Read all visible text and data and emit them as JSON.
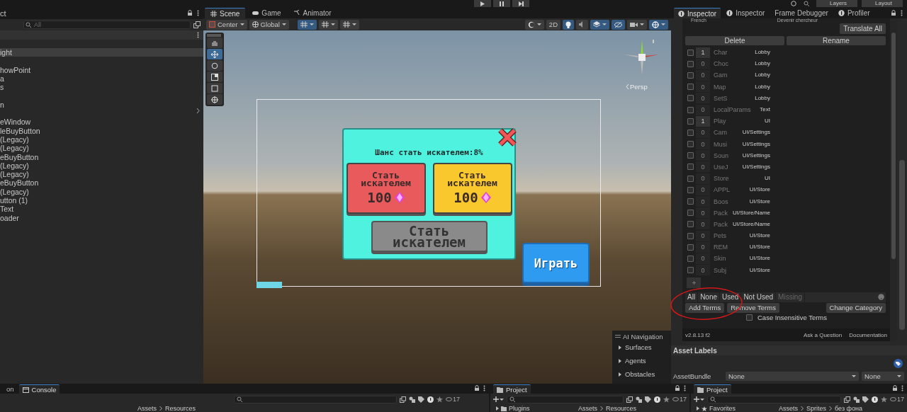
{
  "top_bar": {
    "dropdowns": [
      "Layers",
      "Layout"
    ]
  },
  "hierarchy": {
    "title": "ct",
    "search": {
      "placeholder": "All"
    },
    "rows": [
      {
        "kind": "item",
        "label": "ight",
        "selected": true
      },
      {
        "kind": "blank"
      },
      {
        "kind": "item",
        "label": "howPoint",
        "selected": false
      },
      {
        "kind": "item",
        "label": "a",
        "selected": false
      },
      {
        "kind": "item",
        "label": "s",
        "selected": false
      },
      {
        "kind": "blank"
      },
      {
        "kind": "item",
        "label": "n",
        "selected": false
      },
      {
        "kind": "blank"
      },
      {
        "kind": "item",
        "label": "eWindow",
        "selected": false
      },
      {
        "kind": "item",
        "label": "leBuyButton",
        "selected": false
      },
      {
        "kind": "item",
        "label": "(Legacy)",
        "selected": false
      },
      {
        "kind": "item",
        "label": "(Legacy)",
        "selected": false
      },
      {
        "kind": "item",
        "label": "eBuyButton",
        "selected": false
      },
      {
        "kind": "item",
        "label": "(Legacy)",
        "selected": false
      },
      {
        "kind": "item",
        "label": "(Legacy)",
        "selected": false
      },
      {
        "kind": "item",
        "label": "eBuyButton",
        "selected": false
      },
      {
        "kind": "item",
        "label": "(Legacy)",
        "selected": false
      },
      {
        "kind": "item",
        "label": "utton (1)",
        "selected": false
      },
      {
        "kind": "item",
        "label": "Text",
        "selected": false
      },
      {
        "kind": "item",
        "label": "oader",
        "selected": false
      }
    ]
  },
  "scene": {
    "tabs": [
      {
        "label": "Scene",
        "selected": true
      },
      {
        "label": "Game",
        "selected": false
      },
      {
        "label": "Animator",
        "selected": false
      }
    ],
    "toolbar": {
      "pivot": "Center",
      "space": "Global",
      "mode": "2D"
    },
    "projection": "Persp",
    "popup": {
      "title": "Шанс стать искателем:8%",
      "buttons": [
        {
          "kind": "priced",
          "label": "Стать искателем",
          "price": "100",
          "color": "#e85a5c"
        },
        {
          "kind": "priced",
          "label": "Стать искателем",
          "price": "100",
          "color": "#f8c82c"
        },
        {
          "kind": "plain",
          "label": "Стать искателем",
          "color": "#8a8a8a"
        }
      ]
    },
    "play_button": "Играть",
    "ai_navigation": {
      "title": "AI Navigation",
      "items": [
        "Surfaces",
        "Agents",
        "Obstacles"
      ]
    }
  },
  "inspector": {
    "tabs": [
      {
        "label": "Inspector",
        "selected": true
      },
      {
        "label": "Inspector",
        "selected": false
      },
      {
        "label": "Frame Debugger",
        "selected": false
      },
      {
        "label": "Profiler",
        "selected": false
      }
    ],
    "language_row": {
      "language": "French",
      "translation": "Devenir chercheur"
    },
    "translate_all": "Translate All",
    "actions": [
      "Delete",
      "Rename"
    ],
    "terms": [
      {
        "checked": false,
        "uses": "1",
        "key": "Char",
        "category": "Lobby"
      },
      {
        "checked": false,
        "uses": "0",
        "key": "Choc",
        "category": "Lobby"
      },
      {
        "checked": false,
        "uses": "0",
        "key": "Gam",
        "category": "Lobby"
      },
      {
        "checked": false,
        "uses": "0",
        "key": "Map",
        "category": "Lobby"
      },
      {
        "checked": false,
        "uses": "0",
        "key": "SetS",
        "category": "Lobby"
      },
      {
        "checked": false,
        "uses": "0",
        "key": "LocalParams",
        "category": "Text"
      },
      {
        "checked": false,
        "uses": "1",
        "key": "Play",
        "category": "UI"
      },
      {
        "checked": false,
        "uses": "0",
        "key": "Cam",
        "category": "UI/Settings"
      },
      {
        "checked": false,
        "uses": "0",
        "key": "Musi",
        "category": "UI/Settings"
      },
      {
        "checked": false,
        "uses": "0",
        "key": "Soun",
        "category": "UI/Settings"
      },
      {
        "checked": false,
        "uses": "0",
        "key": "UseJ",
        "category": "UI/Settings"
      },
      {
        "checked": false,
        "uses": "0",
        "key": "Store",
        "category": "UI"
      },
      {
        "checked": false,
        "uses": "0",
        "key": "APPL",
        "category": "UI/Store"
      },
      {
        "checked": false,
        "uses": "0",
        "key": "Boos",
        "category": "UI/Store"
      },
      {
        "checked": false,
        "uses": "0",
        "key": "Pack",
        "category": "UI/Store/Name"
      },
      {
        "checked": false,
        "uses": "0",
        "key": "Pack",
        "category": "UI/Store/Name"
      },
      {
        "checked": false,
        "uses": "0",
        "key": "Pets",
        "category": "UI/Store"
      },
      {
        "checked": false,
        "uses": "0",
        "key": "REM",
        "category": "UI/Store"
      },
      {
        "checked": false,
        "uses": "0",
        "key": "Skin",
        "category": "UI/Store"
      },
      {
        "checked": false,
        "uses": "0",
        "key": "Subj",
        "category": "UI/Store"
      }
    ],
    "filters": [
      {
        "label": "All",
        "disabled": false
      },
      {
        "label": "None",
        "disabled": false
      },
      {
        "label": "Used",
        "disabled": false
      },
      {
        "label": "Not Used",
        "disabled": false
      },
      {
        "label": "Missing",
        "disabled": true
      }
    ],
    "term_buttons": [
      "Add Terms",
      "Remove Terms",
      "Change Category"
    ],
    "case_insensitive": {
      "label": "Case Insensitive Terms",
      "checked": false
    },
    "footer": {
      "version": "v2.8.13 f2",
      "links": [
        "Ask a Question",
        "Documentation"
      ]
    },
    "asset_labels": {
      "title": "Asset Labels",
      "bundle_label": "AssetBundle",
      "bundle": "None",
      "variant": "None"
    }
  },
  "bottom_panels": [
    {
      "tabs": [
        {
          "label": "on",
          "selected": false
        },
        {
          "label": "Console",
          "selected": true
        }
      ],
      "count": "17",
      "breadcrumb": [
        "Assets",
        "Resources"
      ]
    },
    {
      "tabs": [
        {
          "label": "Project",
          "selected": true
        }
      ],
      "tree": "Plugins",
      "count": "17",
      "breadcrumb": [
        "Assets",
        "Resources"
      ]
    },
    {
      "tabs": [
        {
          "label": "Project",
          "selected": true
        }
      ],
      "tree": "Favorites",
      "count": "17",
      "breadcrumb": [
        "Assets",
        "Sprites",
        "без фона"
      ]
    }
  ]
}
